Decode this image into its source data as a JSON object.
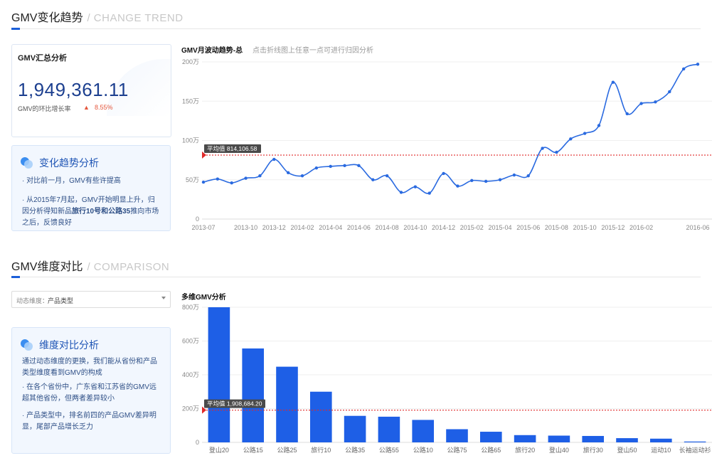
{
  "trend_section": {
    "title": "GMV变化趋势",
    "subtitle": "CHANGE TREND"
  },
  "compare_section": {
    "title": "GMV维度对比",
    "subtitle": "COMPARISON"
  },
  "summary_card": {
    "title": "GMV汇总分析",
    "total": "1,949,361.11",
    "growth_label": "GMV的环比增长率",
    "growth_arrow": "▲",
    "growth_value": "8.55%",
    "up_color": "#e4573d"
  },
  "trend_analysis": {
    "title": "变化趋势分析",
    "p1": "· 对比前一月，GMV有些许提高",
    "p2a": "· 从2015年7月起，GMV开始明显上升，归因分析得知新品",
    "p2b": "旅行10号和公路35",
    "p2c": "推向市场之后，反馈良好"
  },
  "dimension_select": {
    "label": "动态维度：",
    "value": "产品类型"
  },
  "compare_analysis": {
    "title": "维度对比分析",
    "p1": "通过动态维度的更换，我们能从省份和产品类型维度看到GMV的构成",
    "p2": "· 在各个省份中，广东省和江苏省的GMV远超其他省份，但两者差异较小",
    "p3": "· 产品类型中，排名前四的产品GMV差异明显，尾部产品增长乏力"
  },
  "line_chart_header": {
    "title": "GMV月波动趋势-总",
    "hint": "点击折线图上任意一点可进行归因分析"
  },
  "bar_chart_header": {
    "title": "多维GMV分析"
  },
  "colors": {
    "accent": "#1b5fd9",
    "line": "#2a6ae0",
    "bar": "#1e5fe6",
    "avg_line": "#e02a2a",
    "avg_badge": "#4a4a4a"
  },
  "chart_data": [
    {
      "type": "line",
      "title": "GMV月波动趋势-总",
      "yticks": [
        "0",
        "50万",
        "100万",
        "150万",
        "200万"
      ],
      "ylim": [
        0,
        2000000
      ],
      "xtick_labels": [
        "2013-07",
        "2013-10",
        "2013-12",
        "2014-02",
        "2014-04",
        "2014-06",
        "2014-08",
        "2014-10",
        "2014-12",
        "2015-02",
        "2015-04",
        "2015-06",
        "2015-08",
        "2015-10",
        "2015-12",
        "2016-02",
        "2016-06"
      ],
      "xtick_index": [
        0,
        3,
        5,
        7,
        9,
        11,
        13,
        15,
        17,
        19,
        21,
        23,
        25,
        27,
        29,
        31,
        35
      ],
      "values": [
        470000,
        510000,
        460000,
        520000,
        550000,
        760000,
        590000,
        550000,
        650000,
        670000,
        680000,
        680000,
        500000,
        550000,
        340000,
        410000,
        330000,
        580000,
        420000,
        490000,
        480000,
        500000,
        560000,
        550000,
        900000,
        850000,
        1020000,
        1090000,
        1190000,
        1740000,
        1340000,
        1470000,
        1490000,
        1620000,
        1910000,
        1970000
      ],
      "average": 814106.58,
      "average_label": "平均值 814,106.58",
      "grid": true
    },
    {
      "type": "bar",
      "title": "多维GMV分析",
      "categories": [
        "登山20",
        "公路15",
        "公路25",
        "旅行10",
        "公路35",
        "公路55",
        "公路10",
        "公路75",
        "公路65",
        "旅行20",
        "登山40",
        "旅行30",
        "登山50",
        "运动10",
        "长袖运动衫"
      ],
      "values": [
        8000000,
        5560000,
        4480000,
        3000000,
        1570000,
        1520000,
        1330000,
        780000,
        630000,
        430000,
        400000,
        380000,
        250000,
        220000,
        50000
      ],
      "yticks": [
        "0",
        "200万",
        "400万",
        "600万",
        "800万"
      ],
      "ylim": [
        0,
        8000000
      ],
      "average": 1908684.2,
      "average_label": "平均值 1,908,684.20",
      "grid": true
    }
  ]
}
